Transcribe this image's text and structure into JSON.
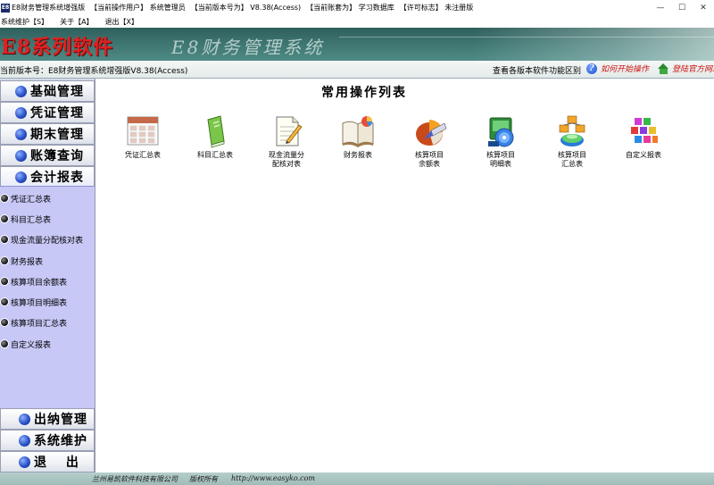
{
  "window": {
    "title": "E8财务管理系统增强版",
    "segments": [
      "【当前操作用户】 系统管理员",
      "【当前版本号为】 V8.38(Access)",
      "【当前账套为】 学习数据库",
      "【许可标志】 未注册版"
    ],
    "app_icon": "E8"
  },
  "menu": [
    {
      "label": "系统维护【S】"
    },
    {
      "label": "关于【A】"
    },
    {
      "label": "退出【X】"
    }
  ],
  "banner": {
    "brand": "E8系列软件",
    "subtitle": "E8财务管理系统"
  },
  "infobar": {
    "version": "当前版本号：E8财务管理系统增强版V8.38(Access)",
    "feature_link": "查看各版本软件功能区别",
    "howto_link": "如何开始操作",
    "login_link": "登陆官方网站"
  },
  "sidebar": {
    "top": [
      {
        "label": "基础管理"
      },
      {
        "label": "凭证管理"
      },
      {
        "label": "期末管理"
      },
      {
        "label": "账簿查询"
      },
      {
        "label": "会计报表"
      }
    ],
    "submenu": [
      {
        "label": "凭证汇总表"
      },
      {
        "label": "科目汇总表"
      },
      {
        "label": "现金流量分配核对表"
      },
      {
        "label": "财务报表"
      },
      {
        "label": "核算项目余额表"
      },
      {
        "label": "核算项目明细表"
      },
      {
        "label": "核算项目汇总表"
      },
      {
        "label": "自定义报表"
      }
    ],
    "bottom": [
      {
        "label": "出纳管理"
      },
      {
        "label": "系统维护"
      },
      {
        "label": "退　 出"
      }
    ]
  },
  "main": {
    "heading": "常用操作列表",
    "tools": [
      {
        "label": "凭证汇总表",
        "icon": "calendar-grid-icon"
      },
      {
        "label": "科目汇总表",
        "icon": "green-books-icon"
      },
      {
        "label": "现金流量分\n配核对表",
        "icon": "document-pen-icon"
      },
      {
        "label": "财务报表",
        "icon": "open-book-icon"
      },
      {
        "label": "核算项目\n余额表",
        "icon": "pie-chart-icon"
      },
      {
        "label": "核算项目\n明细表",
        "icon": "cd-box-icon"
      },
      {
        "label": "核算项目\n汇总表",
        "icon": "globe-stack-icon"
      },
      {
        "label": "自定义报表",
        "icon": "color-blocks-icon"
      }
    ]
  },
  "footer": {
    "company": "兰州易凯软件科技有限公司",
    "rights": "版权所有",
    "url": "http://www.easyko.com"
  }
}
